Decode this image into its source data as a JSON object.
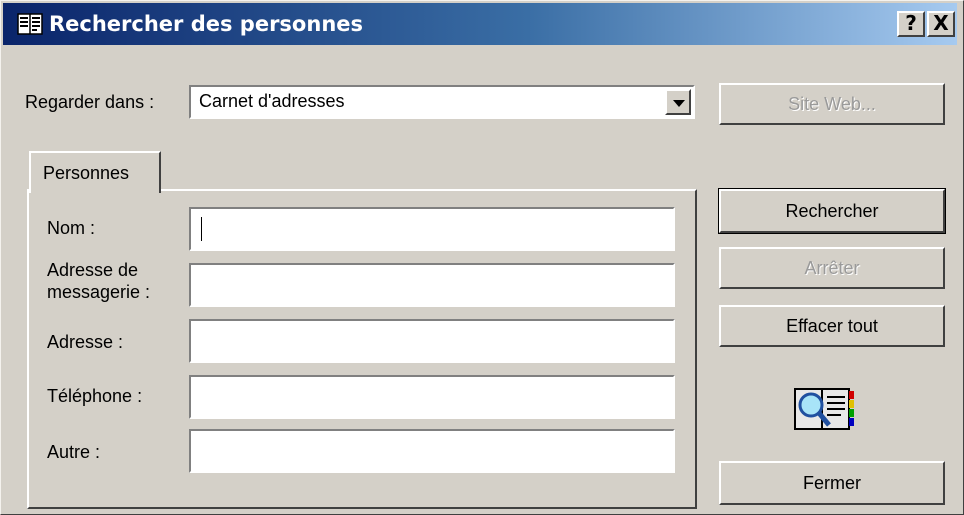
{
  "titlebar": {
    "title": "Rechercher des personnes",
    "help_label": "?",
    "close_label": "X"
  },
  "look_in": {
    "label": "Regarder dans :",
    "value": "Carnet d'adresses"
  },
  "buttons": {
    "website": {
      "label": "Site Web...",
      "enabled": false
    },
    "search": {
      "label": "Rechercher",
      "enabled": true,
      "default": true
    },
    "stop": {
      "label": "Arrêter",
      "enabled": false
    },
    "clear_all": {
      "label": "Effacer tout",
      "enabled": true
    },
    "close": {
      "label": "Fermer",
      "enabled": true
    }
  },
  "tabs": [
    {
      "label": "Personnes",
      "selected": true
    }
  ],
  "fields": {
    "name": {
      "label": "Nom :",
      "value": ""
    },
    "email": {
      "label_line1": "Adresse de",
      "label_line2": "messagerie :",
      "value": ""
    },
    "address": {
      "label": "Adresse :",
      "value": ""
    },
    "phone": {
      "label": "Téléphone :",
      "value": ""
    },
    "other": {
      "label": "Autre :",
      "value": ""
    }
  },
  "icons": {
    "title_icon": "address-book-icon",
    "decor_icon": "address-book-search-icon"
  },
  "colors": {
    "titlebar_start": "#0a246a",
    "titlebar_end": "#a6caf0",
    "face": "#d4d0c8",
    "disabled_text": "#9a9a9a"
  }
}
